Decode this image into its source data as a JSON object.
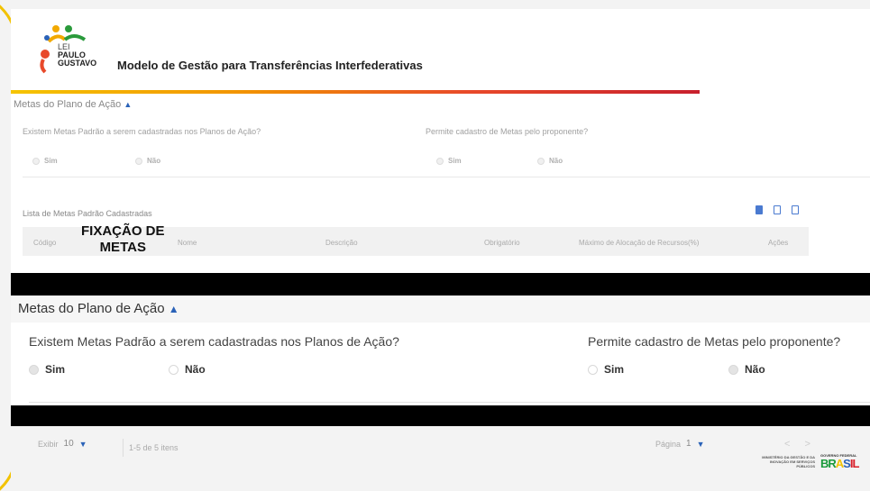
{
  "header": {
    "logo_lei": "LEI",
    "logo_line1": "PAULO",
    "logo_line2": "GUSTAVO",
    "app_title": "Modelo de Gestão para Transferências Interfederativas"
  },
  "section": {
    "title": "Metas do Plano de Ação",
    "question_left": "Existem Metas Padrão a serem cadastradas nos Planos de Ação?",
    "question_right": "Permite cadastro de Metas pelo proponente?",
    "option_yes": "Sim",
    "option_no": "Não",
    "left_selected": "Sim",
    "right_selected": "Não"
  },
  "list": {
    "title": "Lista de Metas Padrão Cadastradas",
    "columns": [
      "Código",
      "Nome",
      "Descrição",
      "Obrigatório",
      "Máximo de Alocação de Recursos(%)",
      "Ações"
    ]
  },
  "overlay": {
    "line1": "FIXAÇÃO DE",
    "line2": "METAS"
  },
  "pagination": {
    "show_label": "Exibir",
    "page_size": "10",
    "range_text": "1-5 de 5 itens",
    "page_label": "Página",
    "page_number": "1"
  },
  "footer": {
    "ministry_text": "MINISTÉRIO DA GESTÃO E DA INOVAÇÃO EM SERVIÇOS PÚBLICOS",
    "gov_label": "GOVERNO FEDERAL",
    "brand_parts": [
      "BR",
      "A",
      "S",
      "IL"
    ]
  },
  "colors": {
    "accent": "#2a62b8",
    "gradient_start": "#f5c400",
    "gradient_end": "#c8202d",
    "arc": "#f2c200"
  }
}
